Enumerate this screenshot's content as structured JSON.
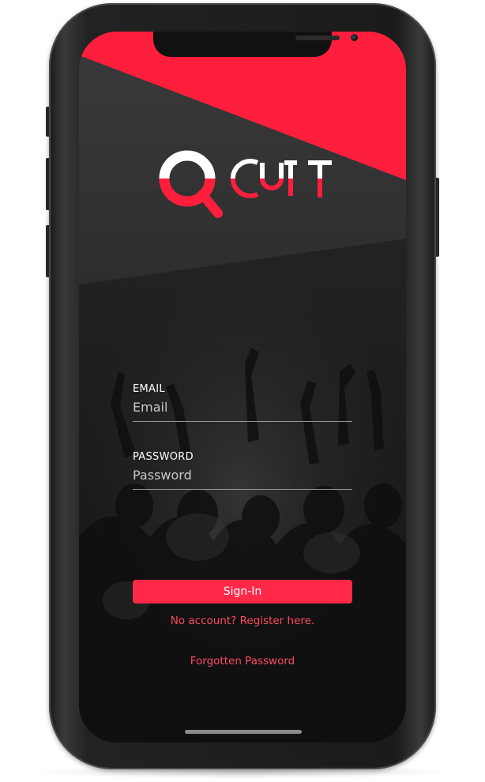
{
  "app": {
    "brand_name": "Q CUT"
  },
  "colors": {
    "accent": "#ff2847",
    "link": "#ff4a62",
    "screen_background": "#1c1c1c"
  },
  "login_form": {
    "email": {
      "label": "EMAIL",
      "placeholder": "Email",
      "value": ""
    },
    "password": {
      "label": "PASSWORD",
      "placeholder": "Password",
      "value": ""
    },
    "signin_label": "Sign-In",
    "register_link": "No account? Register here.",
    "forgot_link": "Forgotten Password"
  },
  "icons": {
    "logo": "qcut-logo",
    "camera": "front-camera",
    "speaker": "earpiece-speaker"
  }
}
